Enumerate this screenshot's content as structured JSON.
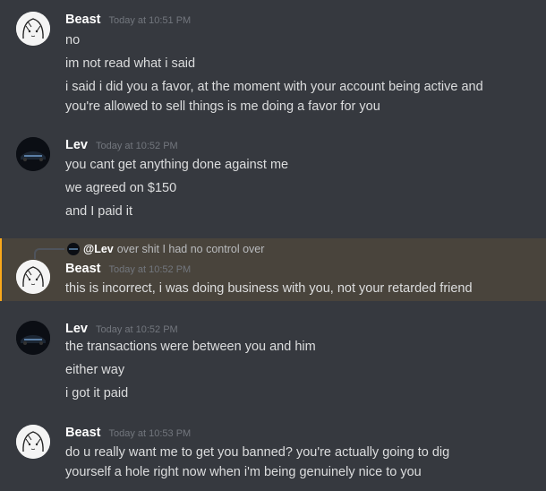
{
  "messages": [
    {
      "author": "Beast",
      "timestamp": "Today at 10:51 PM",
      "lines": [
        "no",
        "im not read what i said",
        "i said i did you a favor, at the moment with your account being active and",
        "you're allowed to sell things is me doing a favor for you"
      ]
    },
    {
      "author": "Lev",
      "timestamp": "Today at 10:52 PM",
      "lines": [
        "you cant get anything done against me",
        "we agreed on $150",
        "and I paid it"
      ]
    },
    {
      "author": "Beast",
      "timestamp": "Today at 10:52 PM",
      "reply": {
        "author": "@Lev",
        "text": "over shit I had no control over"
      },
      "lines": [
        "this is incorrect, i was doing business with you, not your retarded friend"
      ]
    },
    {
      "author": "Lev",
      "timestamp": "Today at 10:52 PM",
      "lines": [
        "the transactions were between you and him",
        "either way",
        "i got it paid"
      ]
    },
    {
      "author": "Beast",
      "timestamp": "Today at 10:53 PM",
      "lines": [
        "do u really want me to get you banned? you're actually going to dig",
        "yourself a hole right now when i'm being genuinely nice to you"
      ]
    }
  ],
  "colors": {
    "background": "#36393f",
    "mention_bg": "#49443c",
    "mention_bar": "#faa81a",
    "author": "#ffffff",
    "timestamp": "#72767d",
    "text": "#dcddde"
  },
  "icons": {
    "beast_avatar": "anime-girl-sketch-avatar",
    "lev_avatar": "dark-car-avatar"
  }
}
